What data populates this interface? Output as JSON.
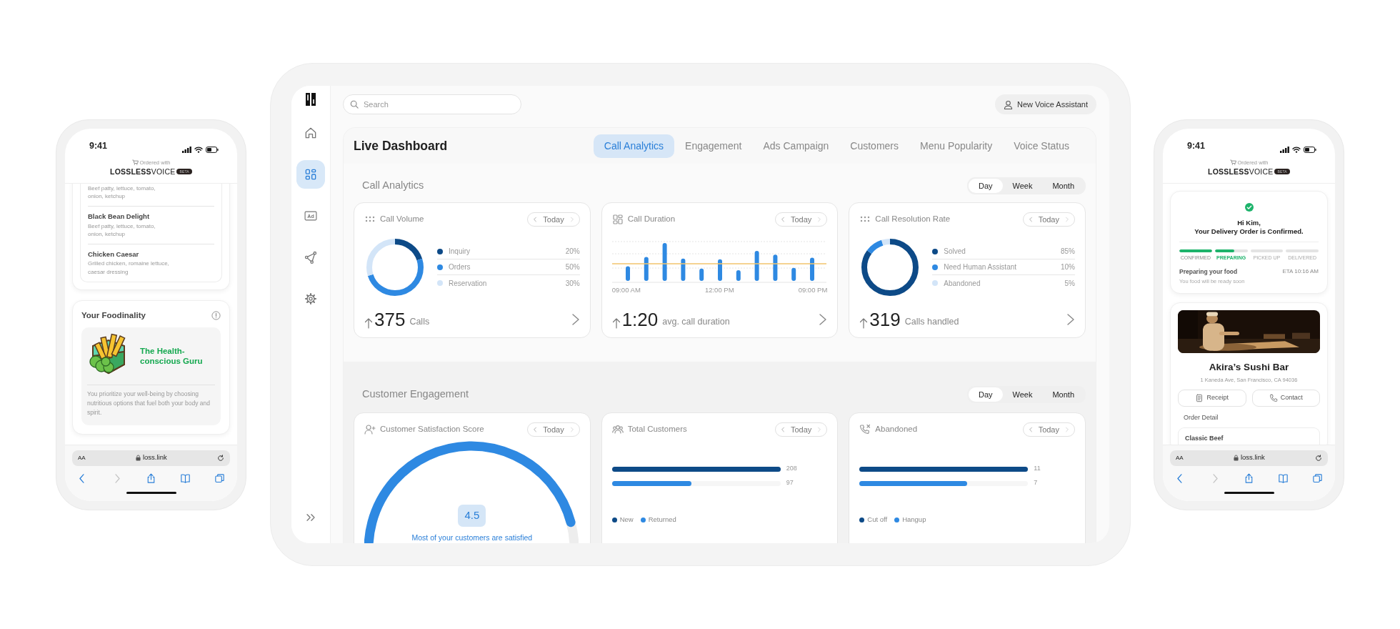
{
  "phones": [
    {
      "kind": "menu",
      "time": "9:41",
      "ordered_with": "Ordered with",
      "brand": "**LOSSLESS**VOICE",
      "beta": "BETA",
      "menu_items": [
        {
          "description": "Beef patty, lettuce, tomato, onion, ketchup"
        },
        {
          "name": "Black Bean Delight",
          "description": "Beef patty, lettuce, tomato, onion, ketchup"
        },
        {
          "name": "Chicken Caesar",
          "description": "Grilled chicken, romaine lettuce, caesar dressing"
        }
      ],
      "foodinality": {
        "title": "Your Foodinality",
        "persona": "The Health-conscious Guru",
        "description": "You prioritize your well-being by choosing nutritious options that fuel both your body and spirit."
      },
      "text_size": "AA",
      "url": "loss.link",
      "toolbar": [
        {
          "kind": "back",
          "disabled": false
        },
        {
          "kind": "forward",
          "disabled": true
        },
        {
          "kind": "share",
          "disabled": false
        },
        {
          "kind": "bookmarks",
          "disabled": false
        },
        {
          "kind": "tabs",
          "disabled": false
        }
      ]
    },
    {
      "kind": "order",
      "time": "9:41",
      "ordered_with": "Ordered with",
      "brand": "**LOSSLESS**VOICE",
      "beta": "BETA",
      "order": {
        "greeting": "Hi Kim,",
        "headline": "Your Delivery Order is Confirmed.",
        "steps": [
          {
            "label": "CONFIRMED",
            "level": 1,
            "selected": false
          },
          {
            "label": "PREPARING",
            "level": 0.6,
            "selected": true
          },
          {
            "label": "PICKED UP",
            "level": 0,
            "selected": false
          },
          {
            "label": "DELIVERED",
            "level": 0,
            "selected": false
          }
        ],
        "status": "Preparing your food",
        "eta": "ETA 10:16 AM",
        "note": "You food will be ready soon"
      },
      "restaurant": {
        "photo": {
          "kind": "picture"
        },
        "name": "Akira’s Sushi Bar",
        "address": "1 Kaneda Ave, San Francisco, CA 94036",
        "buttons": [
          {
            "kind": "receipt",
            "label": "Receipt"
          },
          {
            "kind": "phone",
            "label": "Contact"
          }
        ],
        "order_detail": "Order Detail",
        "items": [
          "Classic Beef"
        ]
      },
      "text_size": "AA",
      "url": "loss.link",
      "toolbar": [
        {
          "kind": "back",
          "disabled": false
        },
        {
          "kind": "forward",
          "disabled": true
        },
        {
          "kind": "share",
          "disabled": false
        },
        {
          "kind": "bookmarks",
          "disabled": false
        },
        {
          "kind": "tabs",
          "disabled": false
        }
      ]
    }
  ],
  "dashboard": {
    "sidebar": {
      "items": [
        {
          "kind": "home",
          "selected": false
        },
        {
          "kind": "dashboard",
          "selected": true
        },
        {
          "kind": "ad",
          "label": "Ad",
          "selected": false
        },
        {
          "kind": "nodes",
          "selected": false
        },
        {
          "kind": "settings",
          "selected": false
        },
        {
          "kind": "expand",
          "selected": false
        }
      ]
    },
    "search": {
      "placeholder": "Search"
    },
    "new_assistant_button": "New Voice Assistant",
    "title": "Live Dashboard",
    "tabs": [
      {
        "label": "Call Analytics",
        "selected": true
      },
      {
        "label": "Engagement",
        "selected": false
      },
      {
        "label": "Ads Campaign",
        "selected": false
      },
      {
        "label": "Customers",
        "selected": false
      },
      {
        "label": "Menu Popularity",
        "selected": false
      },
      {
        "label": "Voice Status",
        "selected": false
      }
    ],
    "sections": [
      {
        "title": "Call Analytics",
        "periods": [
          {
            "label": "Day",
            "selected": true
          },
          {
            "label": "Week",
            "selected": false
          },
          {
            "label": "Month",
            "selected": false
          }
        ],
        "cards": [
          {
            "kind": "donut",
            "title": "Call Volume",
            "range": "Today",
            "total": "375",
            "unit": "Calls",
            "chart_data": {
              "type": "donut",
              "categories": [
                "Inquiry",
                "Orders",
                "Reservation"
              ],
              "values": [
                20,
                50,
                30
              ],
              "value_labels": [
                "20%",
                "50%",
                "30%"
              ],
              "colors": [
                "#0d4a87",
                "#2e89e2",
                "#d3e5f8"
              ]
            }
          },
          {
            "kind": "timeline",
            "title": "Call Duration",
            "range": "Today",
            "x_labels": [
              "09:00 AM",
              "12:00 PM",
              "09:00 PM"
            ],
            "total": "1:20",
            "unit": "avg. call duration"
          },
          {
            "kind": "donut",
            "title": "Call Resolution Rate",
            "range": "Today",
            "total": "319",
            "unit": "Calls handled",
            "chart_data": {
              "type": "donut",
              "categories": [
                "Solved",
                "Need Human Assistant",
                "Abandoned"
              ],
              "values": [
                85,
                10,
                5
              ],
              "value_labels": [
                "85%",
                "10%",
                "5%"
              ],
              "colors": [
                "#0d4a87",
                "#2e89e2",
                "#d3e5f8"
              ]
            }
          }
        ]
      },
      {
        "title": "Customer Engagement",
        "periods": [
          {
            "label": "Day",
            "selected": true
          },
          {
            "label": "Week",
            "selected": false
          },
          {
            "label": "Month",
            "selected": false
          }
        ],
        "cards": [
          {
            "kind": "gauge",
            "title": "Customer Satisfaction Score",
            "range": "Today",
            "score": "4.5",
            "caption": "Most of your customers are satisfied"
          },
          {
            "kind": "hbar",
            "title": "Total Customers",
            "range": "Today",
            "bars": [
              {
                "name": "New",
                "color": "#0d4a87",
                "value": "208",
                "level": 1
              },
              {
                "name": "Returned",
                "color": "#2e89e2",
                "value": "97",
                "level": 0.47
              }
            ]
          },
          {
            "kind": "hbar",
            "title": "Abandoned",
            "range": "Today",
            "bars": [
              {
                "name": "Cut off",
                "color": "#0d4a87",
                "value": "11",
                "level": 1
              },
              {
                "name": "Hangup",
                "color": "#2e89e2",
                "value": "7",
                "level": 0.64
              }
            ]
          }
        ]
      }
    ]
  }
}
